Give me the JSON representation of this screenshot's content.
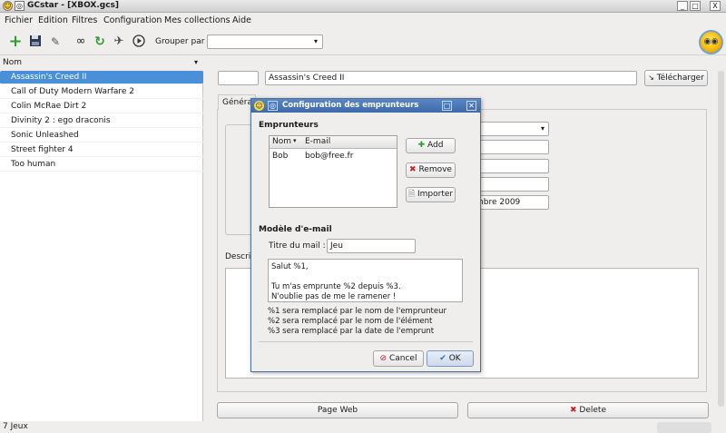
{
  "window": {
    "title": "GCstar - [XBOX.gcs]",
    "btn_min": "_",
    "btn_max": "□",
    "btn_close": "X"
  },
  "menu": [
    "Fichier",
    "Edition",
    "Filtres",
    "Configuration",
    "Mes collections",
    "Aide"
  ],
  "toolbar": {
    "icons": [
      "add-icon",
      "save-icon",
      "preferences-icon",
      "search-icon",
      "refresh-icon",
      "lend-icon",
      "play-icon"
    ],
    "group_label": "Grouper par",
    "group_value": ""
  },
  "list": {
    "header": "Nom",
    "items": [
      "Assassin's Creed II",
      "Call of Duty Modern Warfare 2",
      "Colin McRae Dirt 2",
      "Divinity 2 : ego draconis",
      "Sonic Unleashed",
      "Street fighter 4",
      "Too human"
    ],
    "selected": 0
  },
  "status": "7 Jeux",
  "main": {
    "id_value": "",
    "title_value": "Assassin's Creed II",
    "download_label": "Télécharger",
    "tab_general": "Généra",
    "desc_label": "Descri",
    "date_partial": "mbre 2009",
    "combo_partial": "0",
    "web_page_label": "Page Web",
    "delete_label": "Delete"
  },
  "dialog": {
    "title": "Configuration des emprunteurs",
    "borrowers_heading": "Emprunteurs",
    "col_name": "Nom",
    "col_email": "E-mail",
    "borrowers": [
      {
        "name": "Bob",
        "email": "bob@free.fr"
      }
    ],
    "add_label": "Add",
    "remove_label": "Remove",
    "import_label": "Importer",
    "email_heading": "Modèle d'e-mail",
    "subject_label": "Titre du mail :",
    "subject_value": "Jeu",
    "body_lines": [
      "Salut %1,",
      "",
      "Tu m'as emprunte %2 depuis %3.",
      "N'oublie pas de me le ramener !"
    ],
    "help_lines": [
      "%1 sera remplacé par le nom de l'emprunteur",
      "%2 sera remplacé par le nom de l'élément",
      "%3 sera remplacé par la date de l'emprunt"
    ],
    "cancel_label": "Cancel",
    "ok_label": "OK"
  },
  "colors": {
    "selection": "#4a90d9",
    "dialog_title": "#3e6aaa",
    "add_green": "#2f9a2f",
    "delete_red": "#cc2222"
  }
}
